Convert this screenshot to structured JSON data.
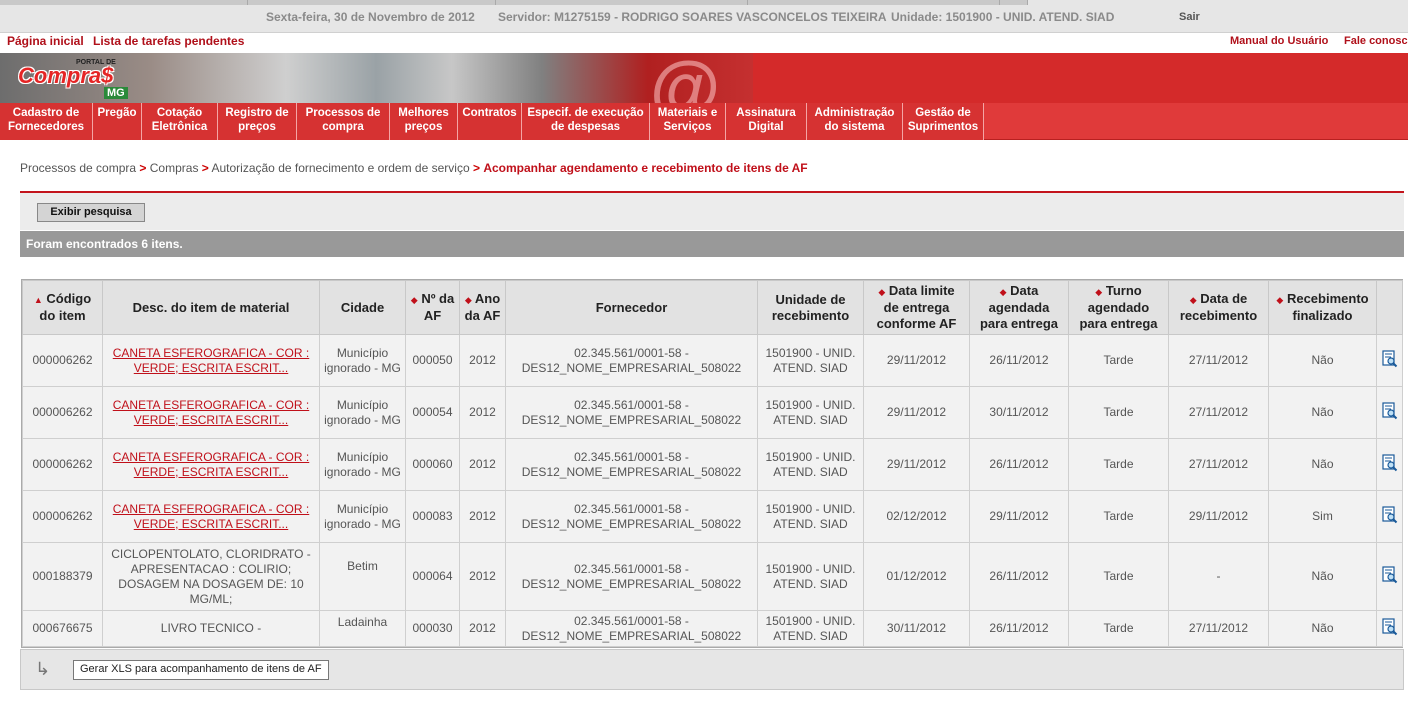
{
  "topbar": {
    "date": "Sexta-feira, 30 de Novembro de 2012",
    "server": "Servidor: M1275159 - RODRIGO SOARES VASCONCELOS TEIXEIRA",
    "unit": "Unidade: 1501900 - UNID. ATEND. SIAD",
    "logout": "Sair"
  },
  "links": {
    "home": "Página inicial",
    "tasks": "Lista de tarefas pendentes",
    "manual": "Manual do Usuário",
    "contact": "Fale conosco"
  },
  "banner": {
    "logo_top": "PORTAL DE",
    "logo_main": "Compra$",
    "logo_state": "MG"
  },
  "menu": [
    {
      "line1": "Cadastro de",
      "line2": "Fornecedores"
    },
    {
      "line1": "Pregão",
      "line2": ""
    },
    {
      "line1": "Cotação",
      "line2": "Eletrônica"
    },
    {
      "line1": "Registro de",
      "line2": "preços"
    },
    {
      "line1": "Processos de",
      "line2": "compra"
    },
    {
      "line1": "Melhores",
      "line2": "preços"
    },
    {
      "line1": "Contratos",
      "line2": ""
    },
    {
      "line1": "Especif. de execução",
      "line2": "de despesas"
    },
    {
      "line1": "Materiais e",
      "line2": "Serviços"
    },
    {
      "line1": "Assinatura",
      "line2": "Digital"
    },
    {
      "line1": "Administração",
      "line2": "do sistema"
    },
    {
      "line1": "Gestão de",
      "line2": "Suprimentos"
    }
  ],
  "breadcrumb": {
    "c1": "Processos de compra",
    "c2": "Compras",
    "c3": "Autorização de fornecimento e ordem de serviço",
    "current": "Acompanhar agendamento e recebimento de itens de AF",
    "sep": ">"
  },
  "search": {
    "toggle_label": "Exibir pesquisa"
  },
  "results": {
    "found_text": "Foram encontrados 6 itens."
  },
  "table": {
    "headers": {
      "code": [
        "Código",
        "do item"
      ],
      "desc": "Desc. do item de material",
      "city": "Cidade",
      "af_num": [
        "Nº da",
        "AF"
      ],
      "af_year": [
        "Ano",
        "da AF"
      ],
      "supplier": "Fornecedor",
      "unit": [
        "Unidade de",
        "recebimento"
      ],
      "deadline": [
        "Data limite",
        "de entrega",
        "conforme AF"
      ],
      "scheduled": [
        "Data",
        "agendada",
        "para entrega"
      ],
      "shift": [
        "Turno",
        "agendado",
        "para entrega"
      ],
      "received": [
        "Data de",
        "recebimento"
      ],
      "finished": [
        "Recebimento",
        "finalizado"
      ],
      "up_arrow": "▲",
      "sort_arrow": "◆"
    },
    "rows": [
      {
        "code": "000006262",
        "desc": "CANETA ESFEROGRAFICA - COR : VERDE; ESCRITA ESCRIT...",
        "desc_link": true,
        "city": "Município ignorado - MG",
        "af": "000050",
        "year": "2012",
        "supplier1": "02.345.561/0001-58 -",
        "supplier2": "DES12_NOME_EMPRESARIAL_508022",
        "unit1": "1501900 - UNID.",
        "unit2": "ATEND. SIAD",
        "deadline": "29/11/2012",
        "scheduled": "26/11/2012",
        "shift": "Tarde",
        "received": "27/11/2012",
        "finished": "Não"
      },
      {
        "code": "000006262",
        "desc": "CANETA ESFEROGRAFICA - COR : VERDE; ESCRITA ESCRIT...",
        "desc_link": true,
        "city": "Município ignorado - MG",
        "af": "000054",
        "year": "2012",
        "supplier1": "02.345.561/0001-58 -",
        "supplier2": "DES12_NOME_EMPRESARIAL_508022",
        "unit1": "1501900 - UNID.",
        "unit2": "ATEND. SIAD",
        "deadline": "29/11/2012",
        "scheduled": "30/11/2012",
        "shift": "Tarde",
        "received": "27/11/2012",
        "finished": "Não"
      },
      {
        "code": "000006262",
        "desc": "CANETA ESFEROGRAFICA - COR : VERDE; ESCRITA ESCRIT...",
        "desc_link": true,
        "city": "Município ignorado - MG",
        "af": "000060",
        "year": "2012",
        "supplier1": "02.345.561/0001-58 -",
        "supplier2": "DES12_NOME_EMPRESARIAL_508022",
        "unit1": "1501900 - UNID.",
        "unit2": "ATEND. SIAD",
        "deadline": "29/11/2012",
        "scheduled": "26/11/2012",
        "shift": "Tarde",
        "received": "27/11/2012",
        "finished": "Não"
      },
      {
        "code": "000006262",
        "desc": "CANETA ESFEROGRAFICA - COR : VERDE; ESCRITA ESCRIT...",
        "desc_link": true,
        "city": "Município ignorado - MG",
        "af": "000083",
        "year": "2012",
        "supplier1": "02.345.561/0001-58 -",
        "supplier2": "DES12_NOME_EMPRESARIAL_508022",
        "unit1": "1501900 - UNID.",
        "unit2": "ATEND. SIAD",
        "deadline": "02/12/2012",
        "scheduled": "29/11/2012",
        "shift": "Tarde",
        "received": "29/11/2012",
        "finished": "Sim"
      },
      {
        "code": "000188379",
        "desc": "CICLOPENTOLATO, CLORIDRATO - APRESENTACAO : COLIRIO; DOSAGEM NA DOSAGEM DE: 10 MG/ML;",
        "desc_link": false,
        "city": "Betim",
        "af": "000064",
        "year": "2012",
        "supplier1": "02.345.561/0001-58 -",
        "supplier2": "DES12_NOME_EMPRESARIAL_508022",
        "unit1": "1501900 - UNID.",
        "unit2": "ATEND. SIAD",
        "deadline": "01/12/2012",
        "scheduled": "26/11/2012",
        "shift": "Tarde",
        "received": "-",
        "finished": "Não"
      },
      {
        "code": "000676675",
        "desc": "LIVRO TECNICO -",
        "desc_link": false,
        "city": "Ladainha",
        "af": "000030",
        "year": "2012",
        "supplier1": "02.345.561/0001-58 -",
        "supplier2": "DES12_NOME_EMPRESARIAL_508022",
        "unit1": "1501900 - UNID.",
        "unit2": "ATEND. SIAD",
        "deadline": "30/11/2012",
        "scheduled": "26/11/2012",
        "shift": "Tarde",
        "received": "27/11/2012",
        "finished": "Não"
      }
    ]
  },
  "footer": {
    "xls_label": "Gerar XLS para acompanhamento de itens de AF"
  },
  "colors": {
    "brand_red": "#c0101a",
    "menu_red": "#e03a3a"
  }
}
